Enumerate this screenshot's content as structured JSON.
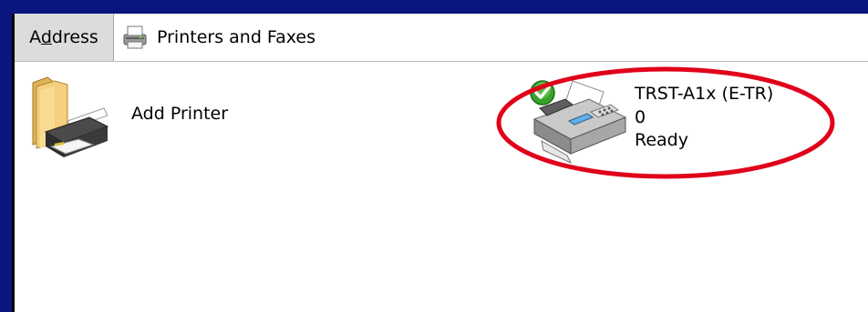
{
  "address_bar": {
    "label": "Address",
    "label_mnemonic": "d",
    "location": "Printers and Faxes",
    "location_icon": "printer-icon"
  },
  "items": [
    {
      "name": "Add Printer",
      "icon": "add-printer-icon"
    },
    {
      "name": "TRST-A1x (E-TR)",
      "documents": "0",
      "status": "Ready",
      "icon": "fax-printer-icon",
      "badge": "default-checkmark-icon"
    }
  ],
  "colors": {
    "frame": "#0a1580",
    "highlight": "#e0001a",
    "checkmark": "#3aa12b"
  }
}
